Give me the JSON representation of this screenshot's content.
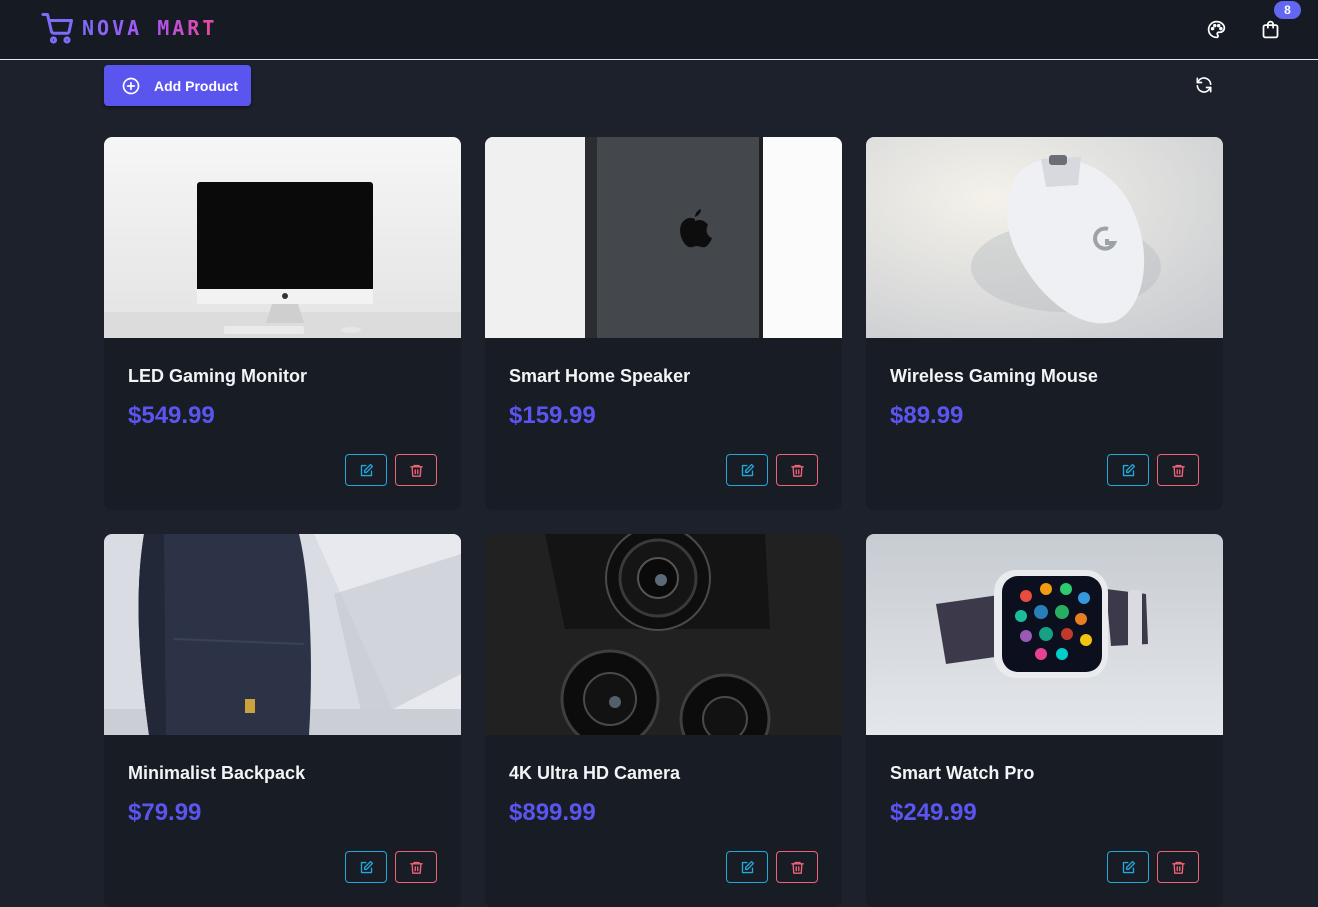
{
  "app": {
    "brand": "NOVA MART",
    "cart_count": "8",
    "brand_color": "#7c6cf7"
  },
  "toolbar": {
    "add_label": "Add Product",
    "add_icon": "plus-circle-icon",
    "refresh_icon": "refresh-icon"
  },
  "colors": {
    "primary": "#5b55f0",
    "edit": "#22a8d9",
    "delete": "#f06277",
    "card_bg": "#171c25",
    "page_bg": "#1c212b"
  },
  "products": [
    {
      "title": "LED Gaming Monitor",
      "price": "$549.99",
      "image": "imac-monitor-photo"
    },
    {
      "title": "Smart Home Speaker",
      "price": "$159.99",
      "image": "iphone-back-photo"
    },
    {
      "title": "Wireless Gaming Mouse",
      "price": "$89.99",
      "image": "white-mouse-photo"
    },
    {
      "title": "Minimalist Backpack",
      "price": "$79.99",
      "image": "navy-backpack-photo"
    },
    {
      "title": "4K Ultra HD Camera",
      "price": "$899.99",
      "image": "camera-lenses-photo"
    },
    {
      "title": "Smart Watch Pro",
      "price": "$249.99",
      "image": "smartwatch-photo"
    }
  ]
}
